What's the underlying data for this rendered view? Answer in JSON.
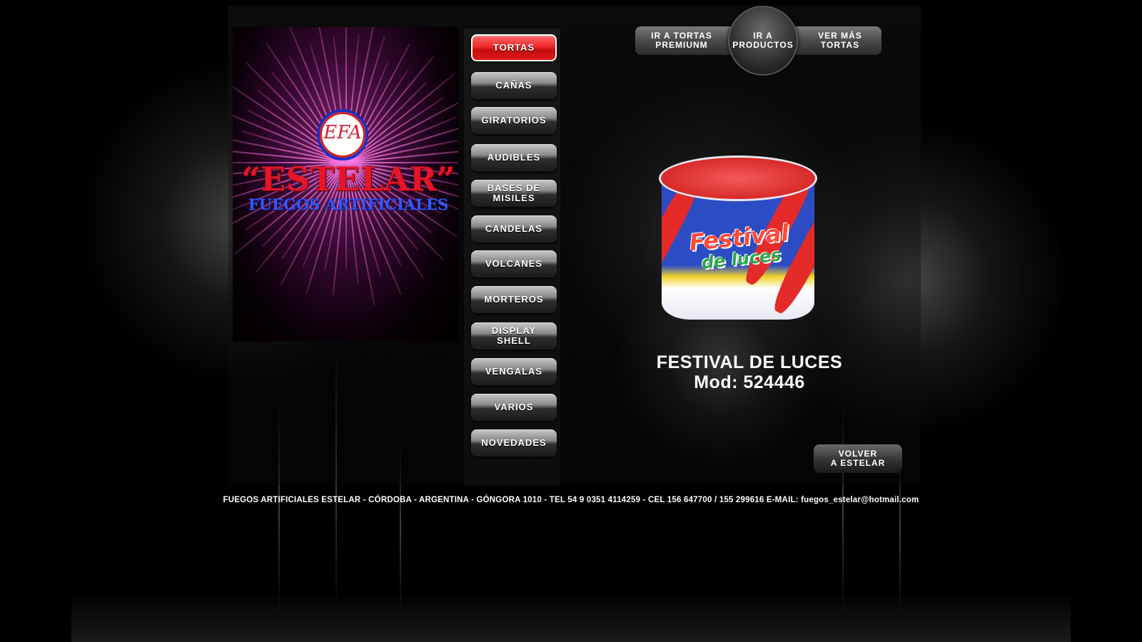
{
  "brand": {
    "logo_initials": "EFA",
    "title": "“ESTELAR”",
    "subtitle": "FUEGOS ARTIFICIALES"
  },
  "nav": {
    "items": [
      {
        "label": "TORTAS",
        "active": true
      },
      {
        "label": "CAÑAS"
      },
      {
        "label": "GIRATORIOS"
      },
      {
        "label": "AUDIBLES"
      },
      {
        "label": "BASES DE\nMISILES"
      },
      {
        "label": "CANDELAS"
      },
      {
        "label": "VOLCANES"
      },
      {
        "label": "MORTEROS"
      },
      {
        "label": "DISPLAY\nSHELL"
      },
      {
        "label": "VENGALAS"
      },
      {
        "label": "VARIOS"
      },
      {
        "label": "NOVEDADES"
      }
    ]
  },
  "top_buttons": {
    "premium": "IR A TORTAS\nPREMIUNM",
    "products": "IR A\nPRODUCTOS",
    "more": "VER MÁS\nTORTAS"
  },
  "product": {
    "name": "FESTIVAL DE LUCES",
    "model": "Mod: 524446",
    "packaging_text": "Festival",
    "packaging_subtext": "de luces"
  },
  "back_button": "VOLVER\nA ESTELAR",
  "footer": "FUEGOS ARTIFICIALES ESTELAR - CÓRDOBA - ARGENTINA - GÓNGORA  1010 - TEL 54 9 0351 4114259 - CEL  156 647700 / 155 299616 E-MAIL: fuegos_estelar@hotmail.com",
  "colors": {
    "active_nav": "#e8202a",
    "brand_red": "#e8142a",
    "brand_blue": "#3355ff",
    "background": "#000000"
  }
}
